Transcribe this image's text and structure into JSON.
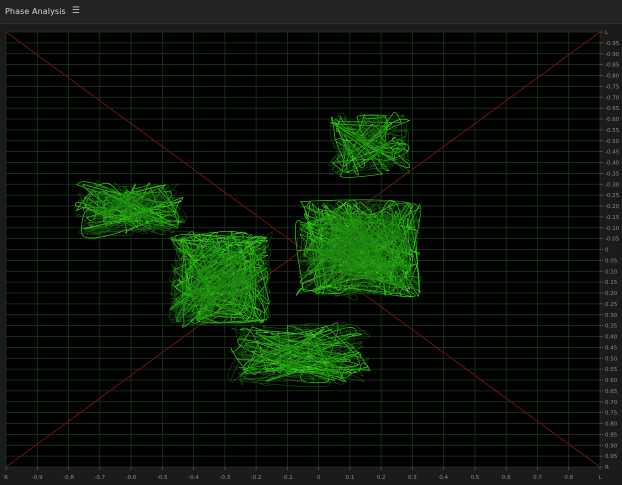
{
  "panel": {
    "title": "Phase Analysis",
    "menu_icon": "hamburger-menu-icon"
  },
  "scope": {
    "left_channel_label": "R",
    "right_channel_label": "L",
    "bottom_axis_ticks": [
      "R",
      "-0.9",
      "-0.8",
      "-0.7",
      "-0.6",
      "-0.5",
      "-0.4",
      "-0.3",
      "-0.2",
      "-0.1",
      "0",
      "0.1",
      "0.2",
      "0.3",
      "0.4",
      "0.5",
      "0.6",
      "0.7",
      "0.8",
      "L"
    ],
    "right_axis_ticks": [
      "L",
      "-0.95",
      "-0.90",
      "-0.85",
      "-0.80",
      "-0.75",
      "-0.70",
      "-0.65",
      "-0.60",
      "-0.55",
      "-0.50",
      "-0.45",
      "-0.40",
      "-0.35",
      "-0.30",
      "-0.25",
      "-0.20",
      "-0.15",
      "-0.10",
      "-0.05",
      "0",
      "0.05",
      "0.10",
      "0.15",
      "0.20",
      "0.25",
      "0.30",
      "0.35",
      "0.40",
      "0.45",
      "0.50",
      "0.55",
      "0.60",
      "0.65",
      "0.70",
      "0.75",
      "0.80",
      "0.85",
      "0.90",
      "0.95",
      "R"
    ],
    "colors": {
      "background": "#000000",
      "grid": "#1d3b1d",
      "diagonals": "#6a1414",
      "trace": "#39ff14",
      "trace_dim": "#1c7a12",
      "axis_text": "#8c8c8c"
    }
  }
}
